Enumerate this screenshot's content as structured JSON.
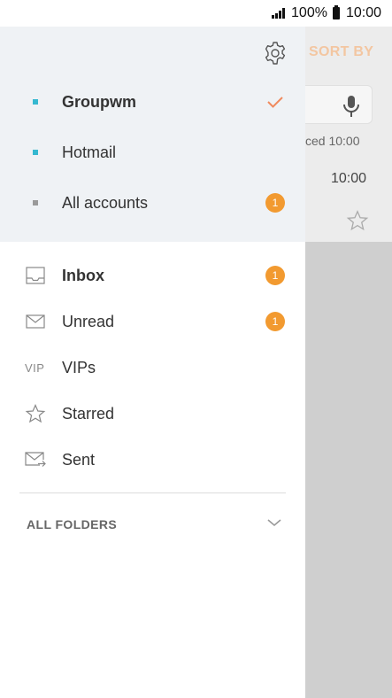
{
  "status_bar": {
    "battery_text": "100%",
    "time": "10:00"
  },
  "background_app": {
    "sort_by_label": "SORT BY",
    "synced_text": "ced  10:00",
    "message_time": "10:00"
  },
  "drawer": {
    "accounts": [
      {
        "label": "Groupwm",
        "dot_color": "#35b8d0",
        "selected": true,
        "bold": true
      },
      {
        "label": "Hotmail",
        "dot_color": "#35b8d0",
        "selected": false,
        "bold": false
      },
      {
        "label": "All accounts",
        "dot_color": "#9a9a9a",
        "selected": false,
        "bold": false,
        "badge": "1"
      }
    ],
    "folders": [
      {
        "label": "Inbox",
        "icon": "inbox-icon",
        "bold": true,
        "badge": "1"
      },
      {
        "label": "Unread",
        "icon": "envelope-icon",
        "bold": false,
        "badge": "1"
      },
      {
        "label": "VIPs",
        "icon": "vip-icon",
        "icon_text": "VIP",
        "bold": false
      },
      {
        "label": "Starred",
        "icon": "star-icon",
        "bold": false
      },
      {
        "label": "Sent",
        "icon": "sent-mail-icon",
        "bold": false
      }
    ],
    "all_folders_label": "ALL FOLDERS"
  },
  "colors": {
    "accent_orange": "#f29a30",
    "check_orange": "#f08a5d",
    "account_dot_blue": "#35b8d0",
    "header_bg": "#eff2f5",
    "overlay_gray": "#cfcfcf"
  }
}
